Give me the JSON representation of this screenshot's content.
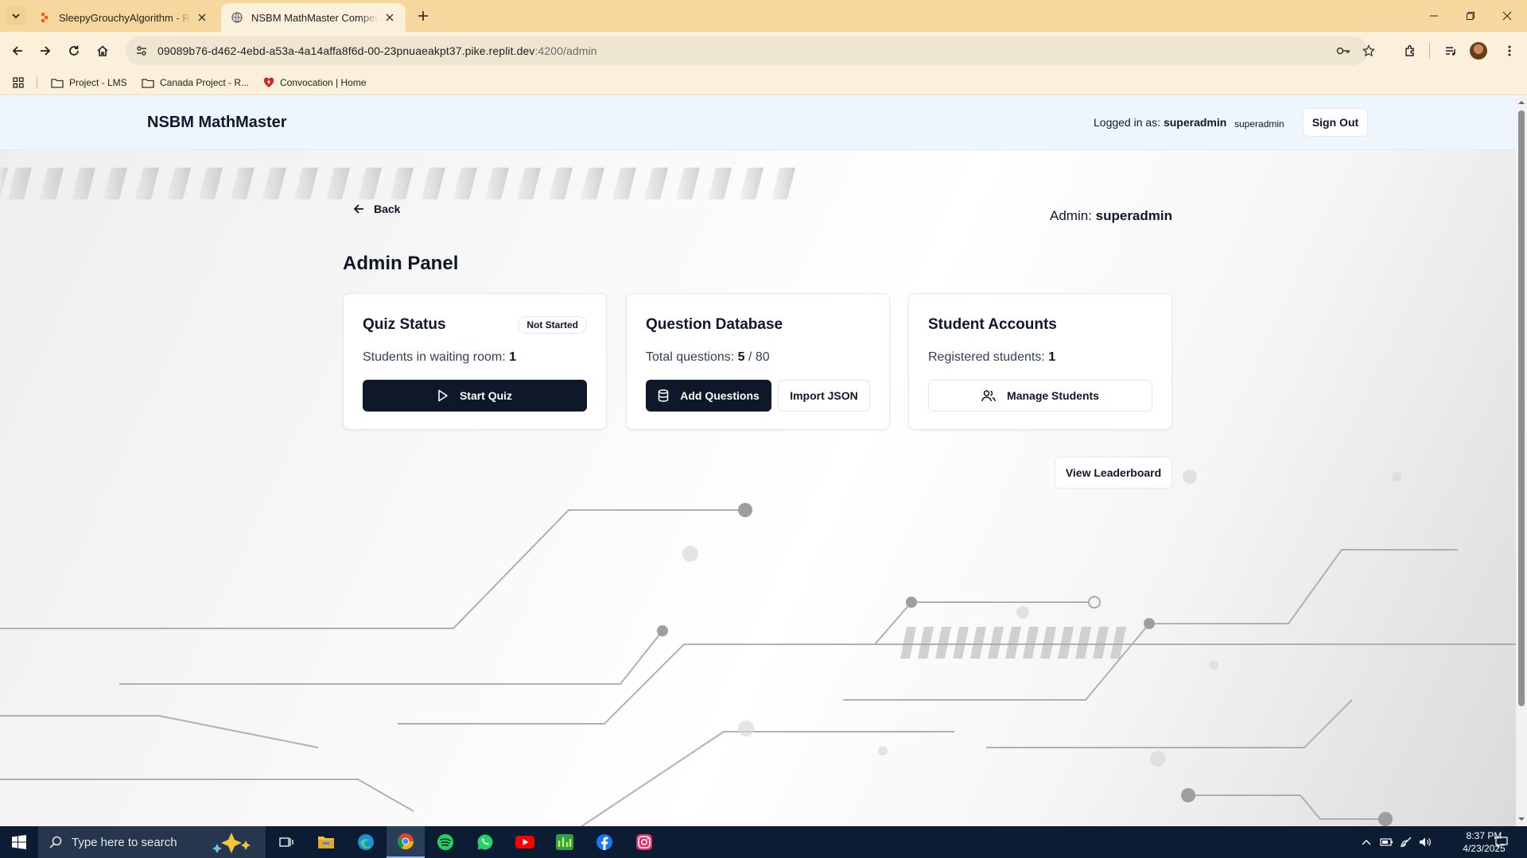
{
  "browser": {
    "tabs": [
      {
        "title": "SleepyGrouchyAlgorithm - Replit",
        "active": false
      },
      {
        "title": "NSBM MathMaster Competition",
        "active": true
      }
    ],
    "url_host": "09089b76-d462-4ebd-a53a-4a14affa8f6d-00-23pnuaeakpt37.pike.replit.dev",
    "url_path": ":4200/admin",
    "bookmarks": [
      {
        "label": "Project - LMS",
        "icon": "folder-icon"
      },
      {
        "label": "Canada Project - R...",
        "icon": "folder-icon"
      },
      {
        "label": "Convocation | Home",
        "icon": "heart-shield-icon"
      }
    ]
  },
  "header": {
    "brand": "NSBM MathMaster",
    "logged_in_prefix": "Logged in as:",
    "logged_in_user": "superadmin",
    "role": "superadmin",
    "sign_out": "Sign Out"
  },
  "page": {
    "back": "Back",
    "admin_prefix": "Admin:",
    "admin_name": "superadmin",
    "title": "Admin Panel",
    "cards": {
      "quiz": {
        "title": "Quiz Status",
        "badge": "Not Started",
        "text_prefix": "Students in waiting room:",
        "text_value": "1",
        "button": "Start Quiz"
      },
      "questions": {
        "title": "Question Database",
        "text_prefix": "Total questions:",
        "text_value": "5",
        "text_suffix": "/ 80",
        "add_button": "Add Questions",
        "import_button": "Import JSON"
      },
      "students": {
        "title": "Student Accounts",
        "text_prefix": "Registered students:",
        "text_value": "1",
        "button": "Manage Students"
      }
    },
    "leaderboard_button": "View Leaderboard"
  },
  "taskbar": {
    "search_placeholder": "Type here to search",
    "time": "8:37 PM",
    "date": "4/23/2025"
  },
  "colors": {
    "primary": "#0f172a",
    "header_bg": "#eef6fd",
    "tabbar_bg": "#f6d79d",
    "taskbar_bg": "#0b1c33"
  }
}
